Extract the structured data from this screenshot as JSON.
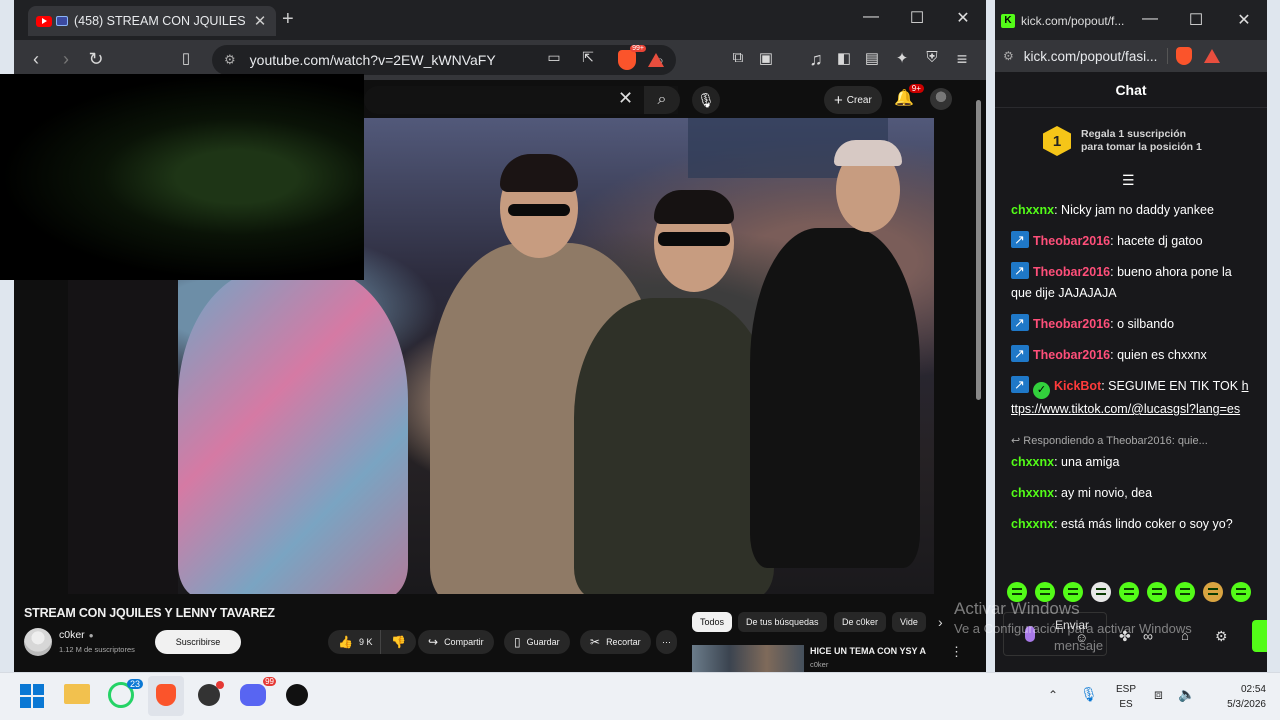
{
  "youtube_browser": {
    "tab_title": "(458) STREAM CON JQUILES",
    "url": "youtube.com/watch?v=2EW_kWNVaFY",
    "brave_badge": "99+"
  },
  "youtube": {
    "create_label": "Crear",
    "notif_count": "9+",
    "video_title": "STREAM CON JQUILES Y LENNY TAVAREZ",
    "channel_name": "c0ker",
    "channel_subs": "1.12 M de suscriptores",
    "subscribe_label": "Suscribirse",
    "likes": "9 K",
    "share_label": "Compartir",
    "save_label": "Guardar",
    "clip_label": "Recortar",
    "chips": [
      "Todos",
      "De tus búsquedas",
      "De c0ker",
      "Vide"
    ],
    "rec_title": "HICE UN TEMA CON YSY A",
    "rec_channel": "c0ker"
  },
  "kick_browser": {
    "tab_title": "kick.com/popout/f...",
    "url": "kick.com/popout/fasi..."
  },
  "kick_chat": {
    "header": "Chat",
    "gift_rank": "1",
    "gift_text_1": "Regala 1 suscripción",
    "gift_text_2": "para tomar la posición 1",
    "messages": [
      {
        "user": "chxxnx",
        "color": "#53fc18",
        "text": ": Nicky jam no daddy yankee"
      },
      {
        "user": "Theobar2016",
        "color": "#ff4f7a",
        "text": ": hacete dj gatoo"
      },
      {
        "user": "Theobar2016",
        "color": "#ff4f7a",
        "text": ": bueno ahora pone la que dije JAJAJAJA"
      },
      {
        "user": "Theobar2016",
        "color": "#ff4f7a",
        "text": ": o silbando"
      },
      {
        "user": "Theobar2016",
        "color": "#ff4f7a",
        "text": ": quien es chxxnx"
      },
      {
        "user": "KickBot",
        "color": "#ff3b3b",
        "text": ": SEGUIME EN TIK TOK ",
        "link": "https://www.tiktok.com/@lucasgsl?lang=es"
      },
      {
        "reply": "Respondiendo a Theobar2016: quie...",
        "user": "chxxnx",
        "color": "#53fc18",
        "text": ": una amiga"
      },
      {
        "user": "chxxnx",
        "color": "#53fc18",
        "text": ": ay mi novio, dea"
      },
      {
        "user": "chxxnx",
        "color": "#53fc18",
        "text": ": está más lindo coker o soy yo?"
      }
    ],
    "send_label": "Enviar"
  },
  "watermark": {
    "line1": "Activar Windows",
    "line2": "Ve a Configuración para activar Windows",
    "line3": "mensaje"
  },
  "taskbar": {
    "whatsapp_badge": "23",
    "discord_badge": "99",
    "lang_1": "ESP",
    "lang_2": "ES",
    "time": "02:54",
    "date": "5/3/2026"
  }
}
